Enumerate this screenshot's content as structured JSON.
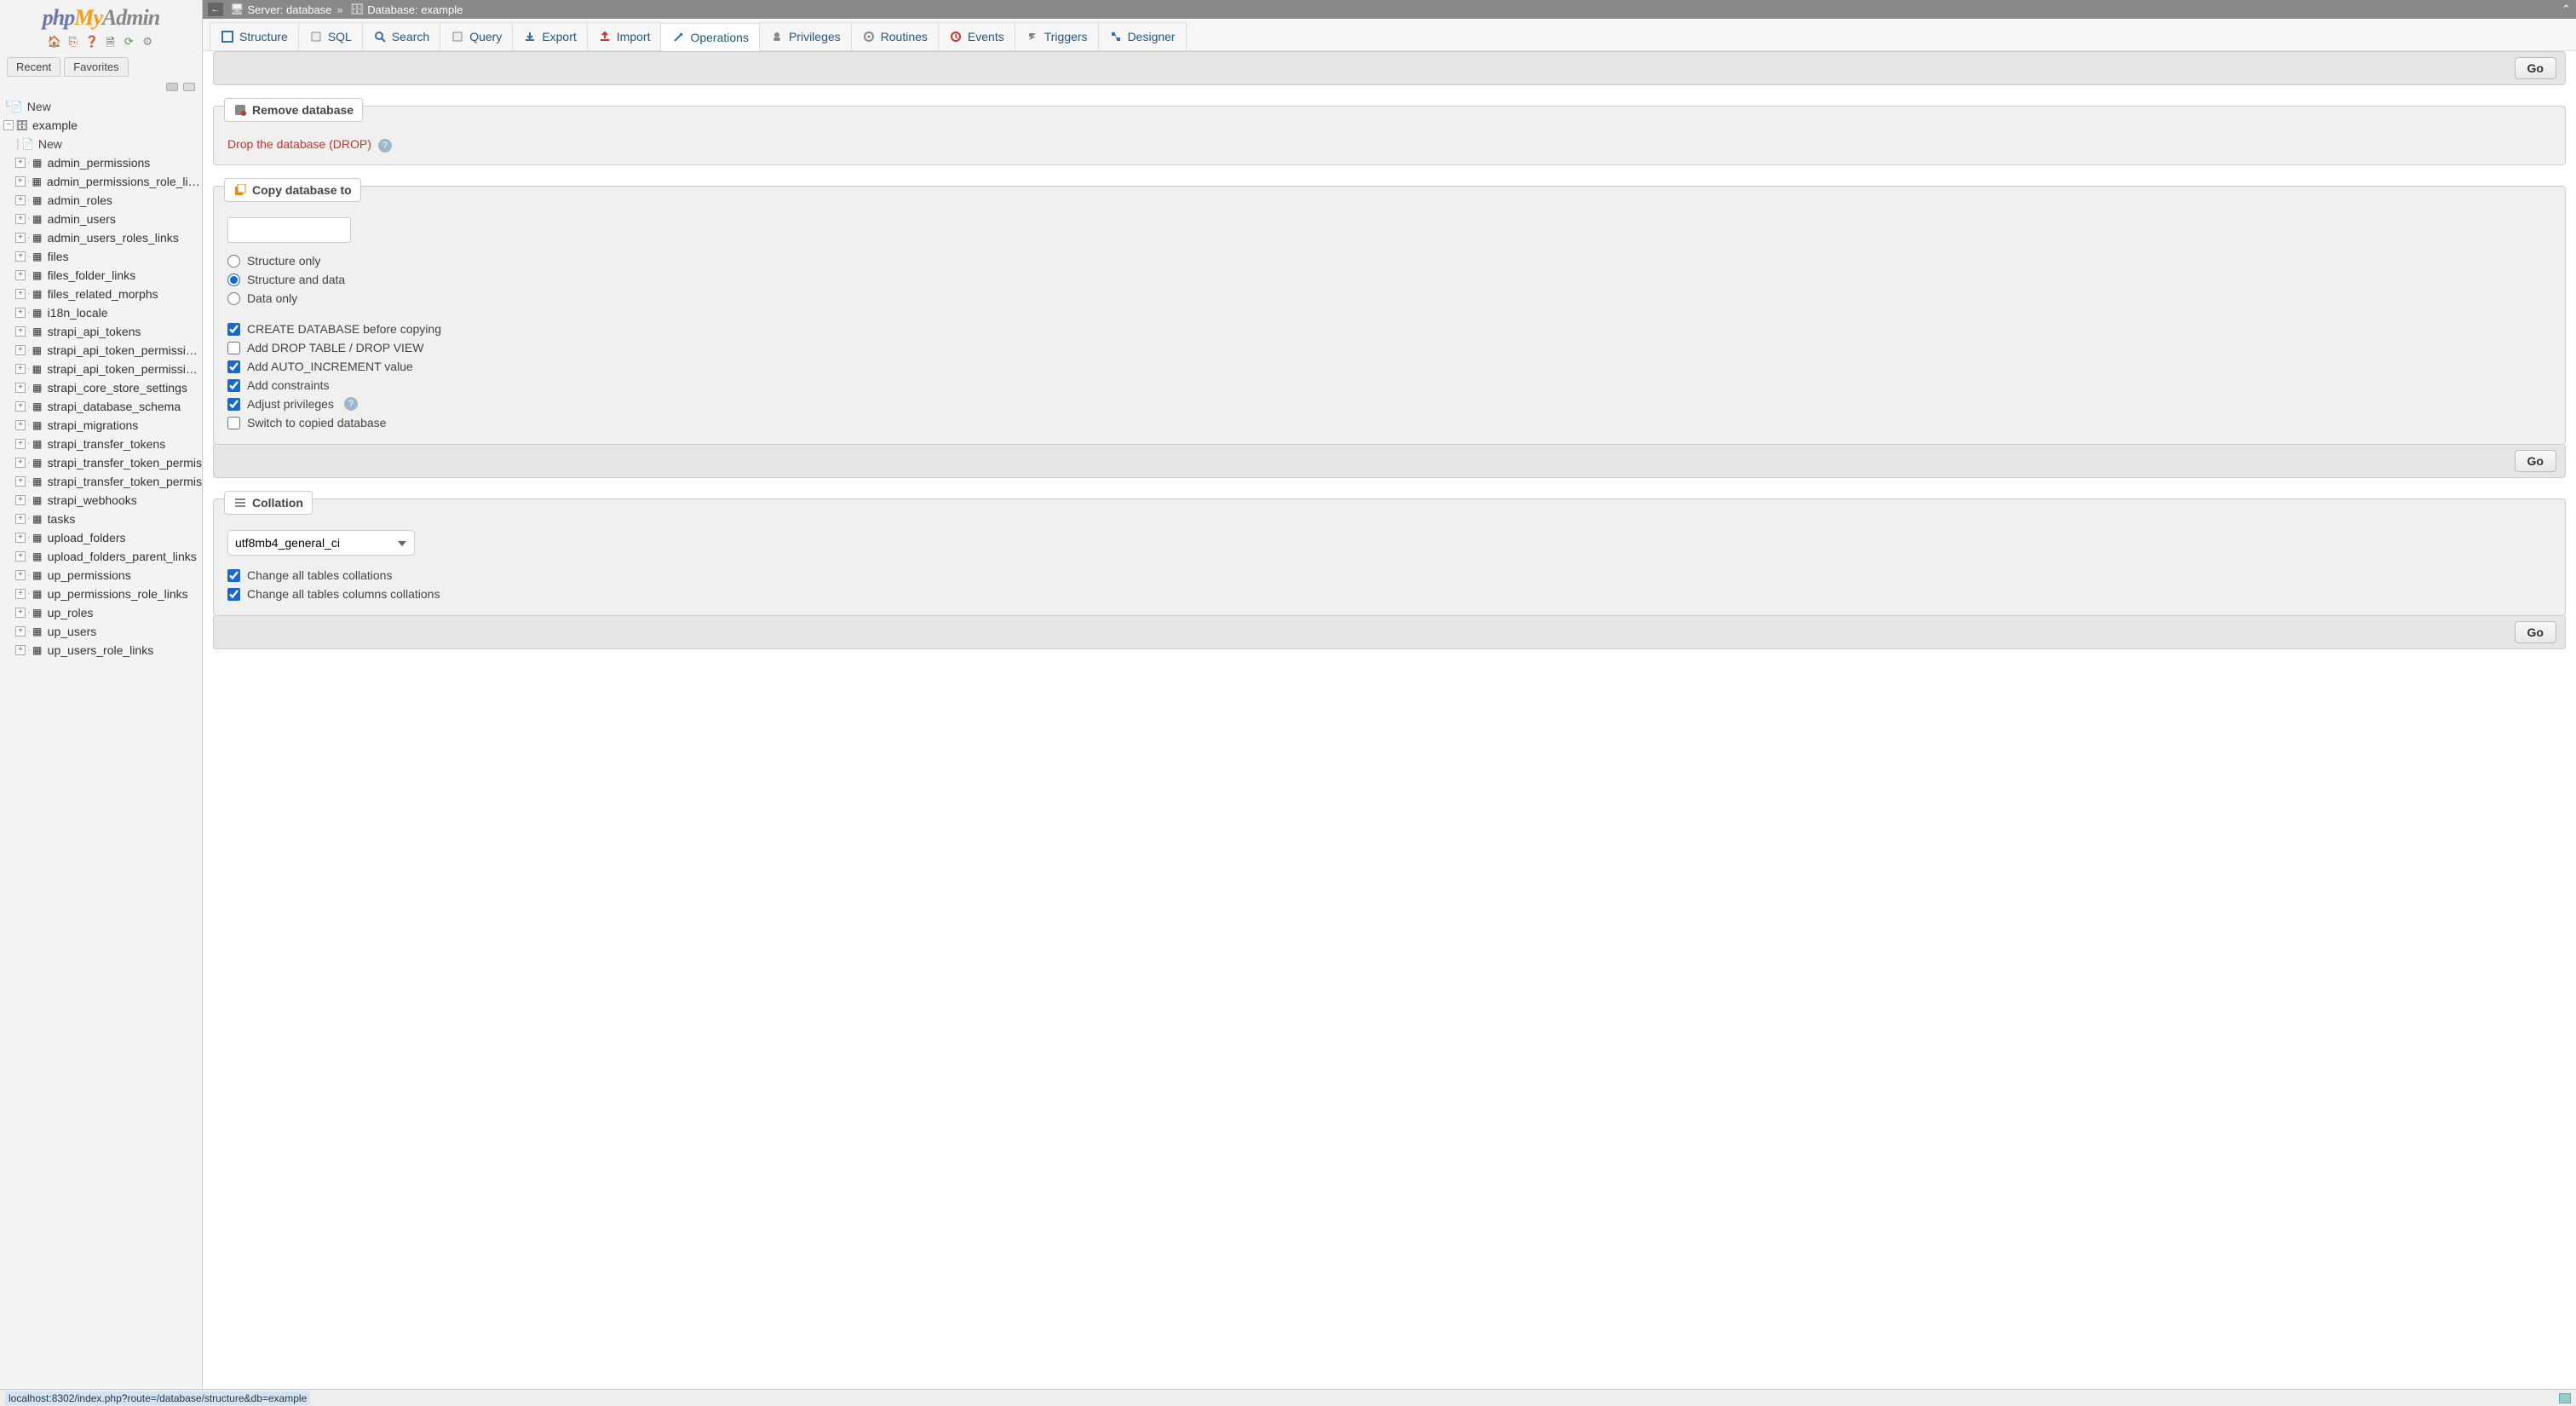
{
  "logo": {
    "part1": "php",
    "part2": "My",
    "part3": "Admin"
  },
  "side_tabs": {
    "recent": "Recent",
    "favorites": "Favorites"
  },
  "tree": {
    "new_top": "New",
    "db": "example",
    "new_db": "New",
    "tables": [
      "admin_permissions",
      "admin_permissions_role_links",
      "admin_roles",
      "admin_users",
      "admin_users_roles_links",
      "files",
      "files_folder_links",
      "files_related_morphs",
      "i18n_locale",
      "strapi_api_tokens",
      "strapi_api_token_permissions",
      "strapi_api_token_permissions",
      "strapi_core_store_settings",
      "strapi_database_schema",
      "strapi_migrations",
      "strapi_transfer_tokens",
      "strapi_transfer_token_permis",
      "strapi_transfer_token_permis",
      "strapi_webhooks",
      "tasks",
      "upload_folders",
      "upload_folders_parent_links",
      "up_permissions",
      "up_permissions_role_links",
      "up_roles",
      "up_users",
      "up_users_role_links"
    ]
  },
  "breadcrumb": {
    "server_label": "Server:",
    "server_value": "database",
    "db_label": "Database:",
    "db_value": "example"
  },
  "tabs": [
    "Structure",
    "SQL",
    "Search",
    "Query",
    "Export",
    "Import",
    "Operations",
    "Privileges",
    "Routines",
    "Events",
    "Triggers",
    "Designer"
  ],
  "active_tab": "Operations",
  "go_label": "Go",
  "panels": {
    "remove": {
      "title": "Remove database",
      "drop_text": "Drop the database (DROP)"
    },
    "copy": {
      "title": "Copy database to",
      "radios": {
        "structure_only": "Structure only",
        "structure_and_data": "Structure and data",
        "data_only": "Data only"
      },
      "checks": {
        "create_db": "CREATE DATABASE before copying",
        "drop_table": "Add DROP TABLE / DROP VIEW",
        "auto_inc": "Add AUTO_INCREMENT value",
        "constraints": "Add constraints",
        "adjust_priv": "Adjust privileges",
        "switch": "Switch to copied database"
      }
    },
    "collation": {
      "title": "Collation",
      "value": "utf8mb4_general_ci",
      "check_tables": "Change all tables collations",
      "check_columns": "Change all tables columns collations"
    }
  },
  "status_url": "localhost:8302/index.php?route=/database/structure&db=example"
}
